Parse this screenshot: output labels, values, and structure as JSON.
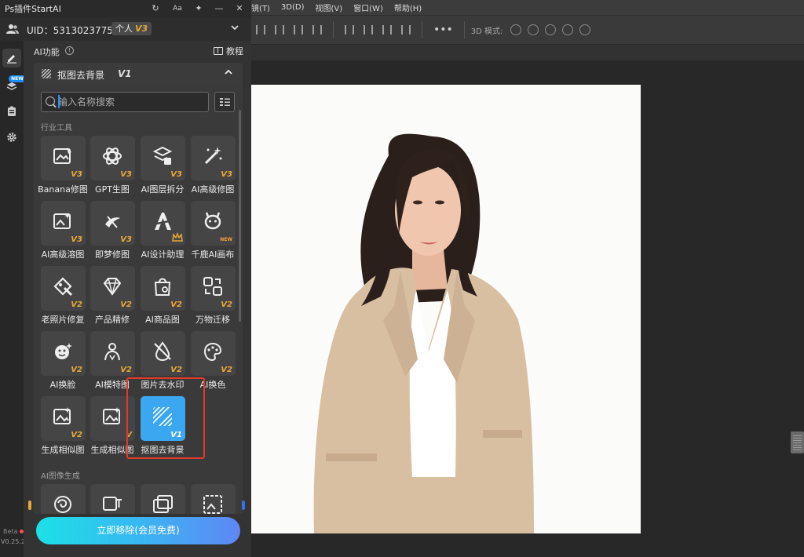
{
  "photoshop": {
    "menu": [
      "镜(T)",
      "3D(D)",
      "视图(V)",
      "窗口(W)",
      "帮助(H)"
    ],
    "options_3d_label": "3D 模式:"
  },
  "plugin": {
    "title": "Ps插件StartAI",
    "title_buttons": {
      "refresh": "↻",
      "font": "Aa",
      "pin": "✦",
      "minimize": "—",
      "close": "✕"
    },
    "uid": "UID：5313023775",
    "plan": "个人",
    "plan_version": "V3",
    "sidebar": {
      "new_badge": "NEW",
      "beta": "Beta",
      "version": "V0.25.2"
    },
    "ai_func_label": "AI功能",
    "tutorial_label": "教程",
    "tool_header": {
      "title": "抠图去背景",
      "version": "V1"
    },
    "search": {
      "placeholder": "输入名称搜索"
    },
    "sections": {
      "industry": "行业工具",
      "image_gen": "AI图像生成"
    },
    "tools": [
      {
        "label": "Banana修图",
        "badge": "V3",
        "icon": "image-edit-icon"
      },
      {
        "label": "GPT生图",
        "badge": "V3",
        "icon": "gpt-icon"
      },
      {
        "label": "AI图层拆分",
        "badge": "V3",
        "icon": "layer-split-icon"
      },
      {
        "label": "AI高级修图",
        "badge": "V3",
        "icon": "magic-wand-icon"
      },
      {
        "label": "AI高级溶图",
        "badge": "V3",
        "icon": "image-blend-icon"
      },
      {
        "label": "即梦修图",
        "badge": "V3",
        "icon": "jimeng-icon"
      },
      {
        "label": "AI设计助理",
        "badge": "",
        "icon": "design-assistant-icon"
      },
      {
        "label": "千鹿AI画布",
        "badge": "NEW",
        "icon": "deer-icon"
      },
      {
        "label": "老照片修复",
        "badge": "V2",
        "icon": "photo-restore-icon"
      },
      {
        "label": "产品精修",
        "badge": "V2",
        "icon": "diamond-icon"
      },
      {
        "label": "AI商品图",
        "badge": "V2",
        "icon": "shopping-bag-icon"
      },
      {
        "label": "万物迁移",
        "badge": "V2",
        "icon": "transfer-icon"
      },
      {
        "label": "AI换脸",
        "badge": "V2",
        "icon": "face-swap-icon"
      },
      {
        "label": "AI模特图",
        "badge": "V2",
        "icon": "model-icon"
      },
      {
        "label": "图片去水印",
        "badge": "V2",
        "icon": "watermark-remove-icon"
      },
      {
        "label": "AI换色",
        "badge": "V2",
        "icon": "color-change-icon"
      },
      {
        "label": "生成相似图",
        "badge": "V2",
        "icon": "similar-image-icon"
      },
      {
        "label": "生成相似图",
        "badge": "V",
        "icon": "similar-image-icon"
      },
      {
        "label": "抠图去背景",
        "badge": "V1",
        "icon": "cutout-icon"
      }
    ],
    "cta": "立即移除(会员免费)"
  },
  "colors": {
    "accent_selected": "#3ba7f0",
    "highlight": "#e23a2a",
    "badge": "#e8a83a"
  }
}
